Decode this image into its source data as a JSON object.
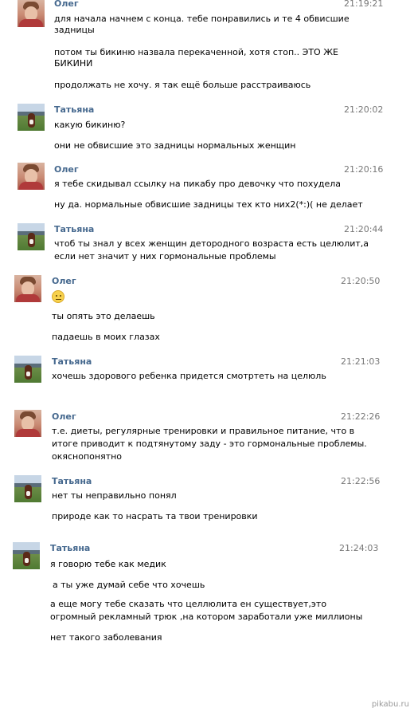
{
  "messages": [
    {
      "author": "Олег",
      "time": "21:19:21",
      "lines": [
        "для начала начнем с конца. тебе понравились и те 4 обвисшие",
        "задницы",
        "потом ты бикиню назвала перекаченной, хотя стоп.. ЭТО ЖЕ",
        "БИКИНИ",
        "продолжать не хочу. я так ещё больше расстраиваюсь"
      ]
    },
    {
      "author": "Татьяна",
      "time": "21:20:02",
      "lines": [
        "какую бикиню?",
        "они не обвисшие это задницы нормальных женщин"
      ]
    },
    {
      "author": "Олег",
      "time": "21:20:16",
      "lines": [
        "я тебе скидывал ссылку на пикабу про девочку что похудела",
        "ну да. нормальные обвисшие задницы тех кто них2(*:)( не делает"
      ]
    },
    {
      "author": "Татьяна",
      "time": "21:20:44",
      "lines": [
        "чтоб ты знал у всех женщин детородного возраста есть целюлит,а",
        "если нет значит у них гормональные проблемы"
      ]
    },
    {
      "author": "Олег",
      "time": "21:20:50",
      "lines": [
        "ты опять это делаешь",
        "падаешь в моих глазах"
      ]
    },
    {
      "author": "Татьяна",
      "time": "21:21:03",
      "lines": [
        "хочешь здорового ребенка придется смотртеть на целюль"
      ]
    },
    {
      "author": "Олег",
      "time": "21:22:26",
      "lines": [
        "т.е. диеты, регулярные тренировки и правильное питание, что в",
        "итоге приводит к подтянутому заду - это гормональные проблемы.",
        "окяснопонятно"
      ]
    },
    {
      "author": "Татьяна",
      "time": "21:22:56",
      "lines": [
        "нет ты неправильно понял",
        "природе как то насрать та твои тренировки"
      ]
    },
    {
      "author": "Татьяна",
      "time": "21:24:03",
      "lines": [
        "я говорю тебе как медик",
        "а ты уже думай себе что хочешь",
        "а еще могу тебе сказать что целлюлита ен существует,это",
        "огромный рекламный трюк ,на котором заработали уже миллионы",
        "нет такого заболевания"
      ]
    }
  ],
  "watermark": "pikabu.ru",
  "colors": {
    "author": "#45688e",
    "time": "#777777",
    "background": "#ffffff"
  }
}
